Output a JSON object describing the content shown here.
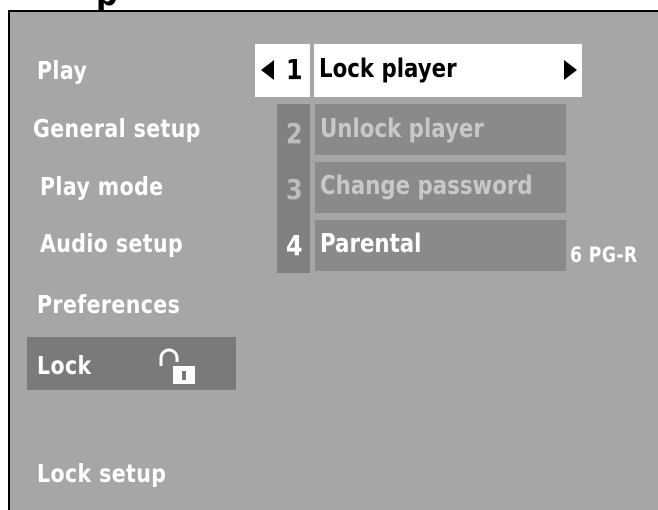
{
  "header": {
    "title_fragment": "p"
  },
  "menu": {
    "items": [
      {
        "label": "Play"
      },
      {
        "label": "General setup"
      },
      {
        "label": "Play mode"
      },
      {
        "label": "Audio setup"
      },
      {
        "label": "Preferences"
      },
      {
        "label": "Lock",
        "selected": true,
        "icon": "open-padlock-icon"
      }
    ]
  },
  "submenu": {
    "items": [
      {
        "number": "1",
        "label": "Lock player",
        "selected": true
      },
      {
        "number": "2",
        "label": "Unlock player",
        "disabled": true
      },
      {
        "number": "3",
        "label": "Change password",
        "disabled": true
      },
      {
        "number": "4",
        "label": "Parental"
      }
    ]
  },
  "parental_value": "6 PG-R",
  "footer": {
    "status": "Lock setup"
  },
  "colors": {
    "background": "#a6a6a6",
    "highlight": "#ffffff",
    "item_bg": "#8a8a8a",
    "lock_highlight": "#7a7a7a",
    "disabled_text": "#c8c8c8",
    "text": "#ffffff"
  }
}
